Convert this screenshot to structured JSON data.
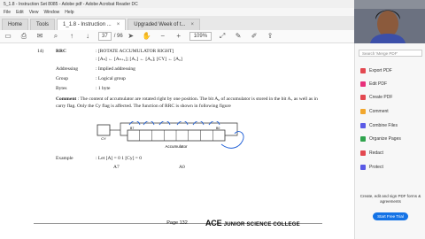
{
  "window": {
    "title": "5_1.8 - Instruction Set 8085 - Adobe pdf - Adobe Acrobat Reader DC"
  },
  "menu": [
    "File",
    "Edit",
    "View",
    "Window",
    "Help"
  ],
  "tabs": [
    {
      "label": "Home"
    },
    {
      "label": "Tools"
    },
    {
      "label": "1_1.8 - Instruction ..."
    },
    {
      "label": "Upgraded Week of t..."
    }
  ],
  "toolbar": {
    "page_current": "37",
    "page_total": "/ 96",
    "zoom": "109%"
  },
  "doc": {
    "item_number": "14)",
    "rows": [
      {
        "k": "RRC",
        "v": ": [ROTATE ACCUMULATOR RIGHT]"
      },
      {
        "k": "",
        "v": ": [Aₙ] ← [Aₙ₊₁]; [A₇] ← [A₀]; [CY] ← [A₀]"
      },
      {
        "k": "Addressing",
        "v": ": Implied addressing"
      },
      {
        "k": "Group",
        "v": ": Logical group"
      },
      {
        "k": "Bytes",
        "v": ": 1 byte"
      }
    ],
    "comment_label": "Comment",
    "comment_text": ": The content of accumulator are rotated right by one position. The bit A₀ of accumulator is stored in the bit A₇ as well as in carry flag. Only the Cy flag is affected. The function of RRC is shown in following figure",
    "diagram": {
      "cy": "CY",
      "acc": "Accumulator",
      "b7": "B7",
      "b0": "B0"
    },
    "example_label": "Example",
    "example_text": ": Let [A] = 0 1 [Cy] = 0",
    "label_a7": "A7",
    "label_a0": "A0",
    "page_label": "Page 132",
    "brand": "ACE",
    "brand_sub": "JUNIOR SCIENCE COLLEGE"
  },
  "rightpane": {
    "search_placeholder": "Search 'Merge PDF'",
    "items": [
      {
        "label": "Export PDF",
        "color": "#e34850"
      },
      {
        "label": "Edit PDF",
        "color": "#e8307a"
      },
      {
        "label": "Create PDF",
        "color": "#e34850"
      },
      {
        "label": "Comment",
        "color": "#f2a72d"
      },
      {
        "label": "Combine Files",
        "color": "#5a5ae6"
      },
      {
        "label": "Organize Pages",
        "color": "#2fa34d"
      },
      {
        "label": "Redact",
        "color": "#e34850"
      },
      {
        "label": "Protect",
        "color": "#5a5ae6"
      }
    ],
    "promo": "Create, edit and sign PDF forms & agreements",
    "trial": "Start Free Trial"
  }
}
